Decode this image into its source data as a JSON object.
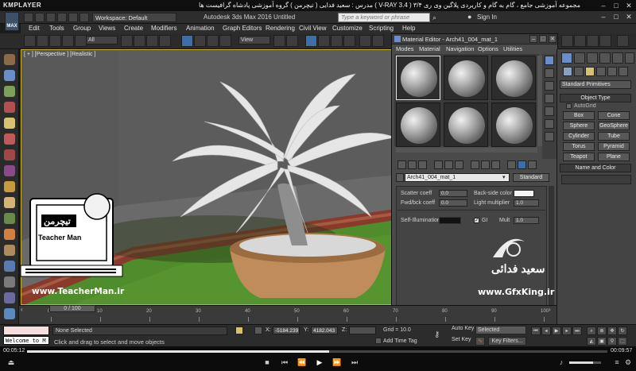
{
  "player": {
    "logo": "KMPLAYER",
    "title": "مجموعه آموزشی جامع ، گام به گام و کاربردی پلاگین وی ری ۳/۴  ( V-RAY 3.4 )  مدرس : سعید فدایی ( تیچرمن ) گروه آموزشی پادشاه گرافیست ها",
    "time_current": "00:05:12",
    "time_total": "00:09:57",
    "progress": 0.52
  },
  "app": {
    "logo": "MAX",
    "workspace": "Workspace: Default",
    "title": "Autodesk 3ds Max 2016   Untitled",
    "search_placeholder": "Type a keyword or phrase",
    "signin": "Sign In"
  },
  "menu": [
    "Edit",
    "Tools",
    "Group",
    "Views",
    "Create",
    "Modifiers",
    "Animation",
    "Graph Editors",
    "Rendering",
    "Civil View",
    "Customize",
    "Scripting",
    "Help"
  ],
  "toolbar": {
    "selection_filter": "All",
    "reference_coord": "View"
  },
  "viewport": {
    "label": "[ + ] [Perspective ] [Realistic ]"
  },
  "material_editor": {
    "title": "Material Editor - Arch41_004_mat_1",
    "menus": [
      "Modes",
      "Material",
      "Navigation",
      "Options",
      "Utilities"
    ],
    "material_name": "Arch41_004_mat_1",
    "material_type": "Standard",
    "params": {
      "scatter_coeff_label": "Scatter coeff",
      "scatter_coeff": "0.0",
      "fwd_bck_label": "Fwd/bck coeff",
      "fwd_bck": "0.0",
      "back_side_label": "Back-side color",
      "light_mult_label": "Light multiplier",
      "light_mult": "1.0",
      "self_illum_label": "Self-Illumination",
      "gi_label": "GI",
      "mult_label": "Mult",
      "mult": "1.0"
    }
  },
  "command_panel": {
    "dropdown": "Standard Primitives",
    "object_type": "Object Type",
    "autogrid": "AutoGrid",
    "primitives": [
      "Box",
      "Cone",
      "Sphere",
      "GeoSphere",
      "Cylinder",
      "Tube",
      "Torus",
      "Pyramid",
      "Teapot",
      "Plane"
    ],
    "name_color": "Name and Color"
  },
  "timeline": {
    "frame": "0 / 100",
    "ticks": [
      "0",
      "10",
      "20",
      "30",
      "40",
      "50",
      "60",
      "70",
      "80",
      "90",
      "100"
    ]
  },
  "status": {
    "maxscript": "Welcome to M",
    "selection": "None Selected",
    "prompt": "Click and drag to select and move objects",
    "x_label": "X:",
    "x": "-5184.239",
    "y_label": "Y:",
    "y": "4182.043",
    "z_label": "Z:",
    "grid": "Grid = 10.0",
    "add_time_tag": "Add Time Tag",
    "auto_key": "Auto Key",
    "set_key": "Set Key",
    "selected": "Selected",
    "key_filters": "Key Filters..."
  },
  "overlays": {
    "teacher_url": "www.TeacherMan.ir",
    "gfx_url": "www.GfxKing.ir",
    "teacher_name": "سعید فدائی",
    "logo_persian": "تیچرمن",
    "logo_english": "Teacher Man"
  },
  "colors": {
    "accent": "#3a6fa8",
    "grass": "#4f8c2c",
    "pot": "#c08c5c",
    "viewport_border": "#c8b022"
  }
}
